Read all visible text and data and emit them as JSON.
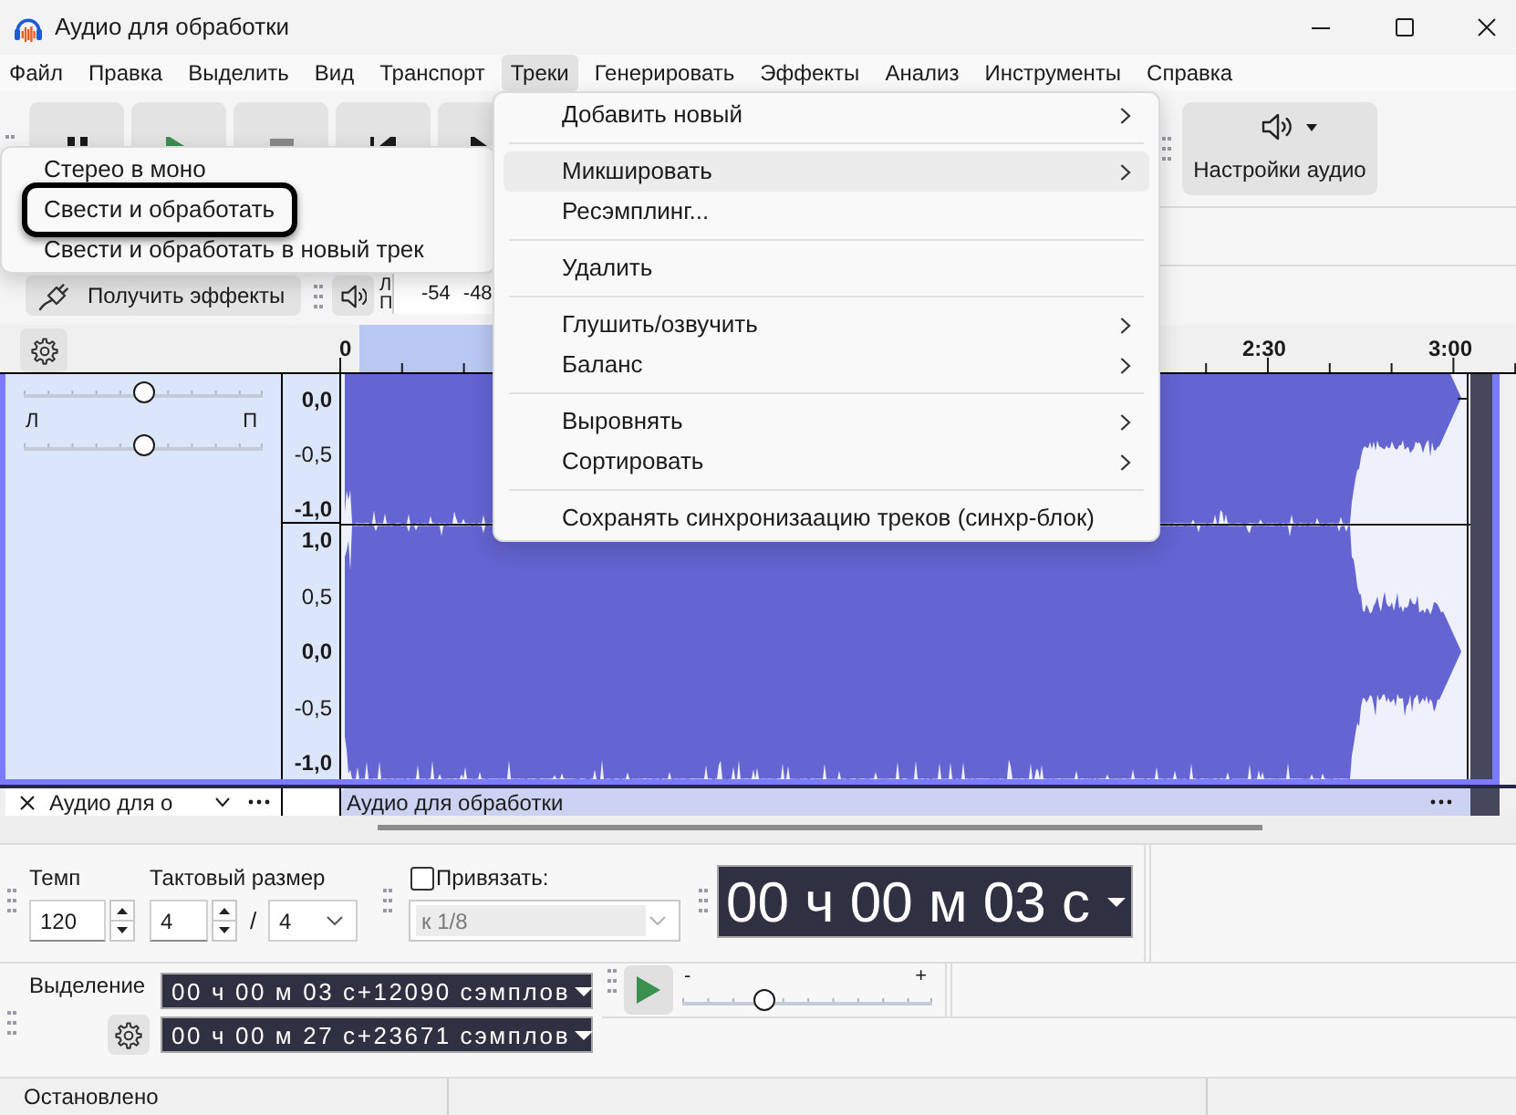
{
  "window": {
    "title": "Аудио для обработки"
  },
  "menu_bar": [
    {
      "label": "Файл",
      "selected": false
    },
    {
      "label": "Правка",
      "selected": false
    },
    {
      "label": "Выделить",
      "selected": false
    },
    {
      "label": "Вид",
      "selected": false
    },
    {
      "label": "Транспорт",
      "selected": false
    },
    {
      "label": "Треки",
      "selected": true
    },
    {
      "label": "Генерировать",
      "selected": false
    },
    {
      "label": "Эффекты",
      "selected": false
    },
    {
      "label": "Анализ",
      "selected": false
    },
    {
      "label": "Инструменты",
      "selected": false
    },
    {
      "label": "Справка",
      "selected": false
    }
  ],
  "transport_buttons": [
    {
      "kind": "pause"
    },
    {
      "kind": "play"
    },
    {
      "kind": "stop"
    },
    {
      "kind": "skip_start"
    },
    {
      "kind": "skip_end"
    }
  ],
  "audio_setup_button": {
    "label": "Настройки аудио"
  },
  "effects_button": {
    "label": "Получить эффекты"
  },
  "meter": {
    "channel_labels": [
      "Л",
      "П"
    ],
    "scale": [
      "-54",
      "-48"
    ]
  },
  "ruler": {
    "labels": [
      "0",
      "2:30",
      "3:00"
    ]
  },
  "track": {
    "selected": true,
    "gain_slider": {
      "level": 0.5
    },
    "pan_labels": [
      "Л",
      "П"
    ],
    "pan_slider": {
      "level": 0.5
    },
    "channels": [
      {
        "scale": [
          {
            "label": "0,0",
            "major": true
          },
          {
            "label": "-0,5",
            "major": false
          },
          {
            "label": "-1,0",
            "major": true
          }
        ]
      },
      {
        "scale": [
          {
            "label": "1,0",
            "major": true
          },
          {
            "label": "0,5",
            "major": false
          },
          {
            "label": "0,0",
            "major": true
          },
          {
            "label": "-0,5",
            "major": false
          },
          {
            "label": "-1,0",
            "major": true
          }
        ]
      }
    ]
  },
  "next_track": {
    "name": "Аудио для о",
    "clip_title": "Аудио для обработки"
  },
  "tempo": {
    "label": "Темп",
    "value": "120"
  },
  "time_signature": {
    "label": "Тактовый размер",
    "numerator": "4",
    "separator": "/",
    "denominator": "4"
  },
  "snap": {
    "label": "Привязать:",
    "checked": false,
    "value": "к 1/8",
    "disabled": true
  },
  "time_display": {
    "value": "00 ч 00 м 03 с"
  },
  "selection": {
    "label": "Выделение",
    "start": "00 ч 00 м 03 с+12090 сэмплов",
    "end": "00 ч 00 м 27 с+23671 сэмплов"
  },
  "play_at_speed": {
    "min_label": "-",
    "max_label": "+",
    "level": 0.33
  },
  "status_bar": {
    "text": "Остановлено"
  },
  "tracks_menu": {
    "items": [
      {
        "kind": "item",
        "label": "Добавить новый",
        "submenu": true,
        "selected": false
      },
      {
        "kind": "separator"
      },
      {
        "kind": "item",
        "label": "Микшировать",
        "submenu": true,
        "selected": true
      },
      {
        "kind": "item",
        "label": "Ресэмплинг...",
        "submenu": false,
        "selected": false
      },
      {
        "kind": "separator"
      },
      {
        "kind": "item",
        "label": "Удалить",
        "submenu": false,
        "selected": false
      },
      {
        "kind": "separator"
      },
      {
        "kind": "item",
        "label": "Глушить/озвучить",
        "submenu": true,
        "selected": false
      },
      {
        "kind": "item",
        "label": "Баланс",
        "submenu": true,
        "selected": false
      },
      {
        "kind": "separator"
      },
      {
        "kind": "item",
        "label": "Выровнять",
        "submenu": true,
        "selected": false
      },
      {
        "kind": "item",
        "label": "Сортировать",
        "submenu": true,
        "selected": false
      },
      {
        "kind": "separator"
      },
      {
        "kind": "item",
        "label": "Сохранять синхронизаацию треков (синхр-блок)",
        "submenu": false,
        "selected": false
      }
    ]
  },
  "mix_submenu": {
    "items": [
      {
        "label": "Стерео в моно",
        "selected": false,
        "annotated": false
      },
      {
        "label": "Свести и обработать",
        "selected": false,
        "annotated": true
      },
      {
        "label": "Свести и обработать в новый трек",
        "selected": false,
        "annotated": false
      }
    ]
  }
}
